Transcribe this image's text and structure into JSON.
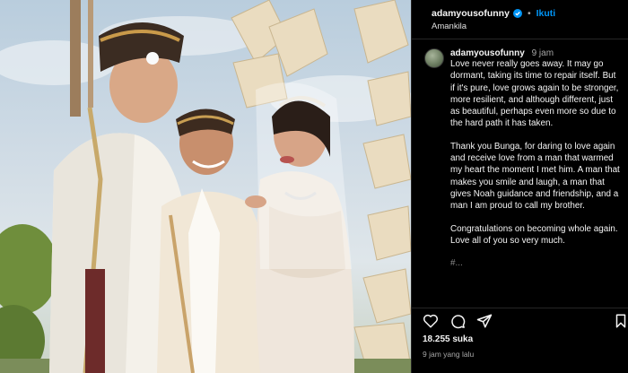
{
  "post": {
    "author": "adamyousofunny",
    "follow_label": "Ikuti",
    "location": "Amankila"
  },
  "caption": {
    "username": "adamyousofunny",
    "time_ago": "9 jam",
    "paragraphs": [
      "Love never really goes away. It may go dormant, taking its time to repair itself. But if it's pure, love grows again to be stronger, more resilient, and although different, just as beautiful, perhaps even more so due to the hard path it has taken.",
      "Thank you Bunga, for daring to love again and receive love from a man that warmed my heart the moment I met him. A man that makes you smile and laugh, a man that gives Noah guidance and friendship, and a man I am proud to call my brother.",
      "Congratulations on becoming whole again. Love all of you so very much."
    ],
    "truncated_line": "#..."
  },
  "stats": {
    "likes": "18.255 suka",
    "posted": "9 jam yang lalu"
  },
  "icons": {
    "like": "heart-icon",
    "comment": "comment-icon",
    "share": "send-icon",
    "save": "bookmark-icon"
  },
  "colors": {
    "follow_blue": "#0095f6",
    "verified_blue": "#0095f6",
    "background": "#000000"
  }
}
